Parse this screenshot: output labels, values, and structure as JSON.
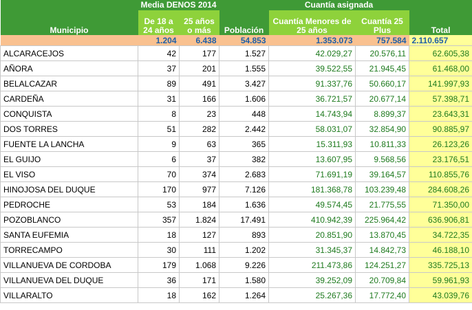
{
  "header": {
    "group_media": "Media DENOS 2014",
    "group_cuantia": "Cuantía asignada",
    "col_municipio": "Municipio",
    "col_18_24": "De 18 a 24 años",
    "col_25_mas": "25 años o más",
    "col_poblacion": "Población",
    "col_menores": "Cuantía Menores de 25 años",
    "col_25plus": "Cuantía 25 Plus",
    "col_total": "Total"
  },
  "totals": {
    "municipio": "",
    "d18_24": "1.204",
    "d25_mas": "6.438",
    "poblacion": "54.853",
    "menores": "1.353.073",
    "plus25": "757.584",
    "total": "2.110.657"
  },
  "rows": [
    {
      "municipio": "ALCARACEJOS",
      "d18_24": "42",
      "d25_mas": "177",
      "poblacion": "1.527",
      "menores": "42.029,27",
      "plus25": "20.576,11",
      "total": "62.605,38"
    },
    {
      "municipio": "AÑORA",
      "d18_24": "37",
      "d25_mas": "201",
      "poblacion": "1.555",
      "menores": "39.522,55",
      "plus25": "21.945,45",
      "total": "61.468,00"
    },
    {
      "municipio": "BELALCAZAR",
      "d18_24": "89",
      "d25_mas": "491",
      "poblacion": "3.427",
      "menores": "91.337,76",
      "plus25": "50.660,17",
      "total": "141.997,93"
    },
    {
      "municipio": "CARDEÑA",
      "d18_24": "31",
      "d25_mas": "166",
      "poblacion": "1.606",
      "menores": "36.721,57",
      "plus25": "20.677,14",
      "total": "57.398,71"
    },
    {
      "municipio": "CONQUISTA",
      "d18_24": "8",
      "d25_mas": "23",
      "poblacion": "448",
      "menores": "14.743,94",
      "plus25": "8.899,37",
      "total": "23.643,31"
    },
    {
      "municipio": "DOS TORRES",
      "d18_24": "51",
      "d25_mas": "282",
      "poblacion": "2.442",
      "menores": "58.031,07",
      "plus25": "32.854,90",
      "total": "90.885,97"
    },
    {
      "municipio": "FUENTE LA LANCHA",
      "d18_24": "9",
      "d25_mas": "63",
      "poblacion": "365",
      "menores": "15.311,93",
      "plus25": "10.811,33",
      "total": "26.123,26"
    },
    {
      "municipio": "EL GUIJO",
      "d18_24": "6",
      "d25_mas": "37",
      "poblacion": "382",
      "menores": "13.607,95",
      "plus25": "9.568,56",
      "total": "23.176,51"
    },
    {
      "municipio": "EL VISO",
      "d18_24": "70",
      "d25_mas": "374",
      "poblacion": "2.683",
      "menores": "71.691,19",
      "plus25": "39.164,57",
      "total": "110.855,76"
    },
    {
      "municipio": "HINOJOSA DEL DUQUE",
      "d18_24": "170",
      "d25_mas": "977",
      "poblacion": "7.126",
      "menores": "181.368,78",
      "plus25": "103.239,48",
      "total": "284.608,26"
    },
    {
      "municipio": "PEDROCHE",
      "d18_24": "53",
      "d25_mas": "184",
      "poblacion": "1.636",
      "menores": "49.574,45",
      "plus25": "21.775,55",
      "total": "71.350,00"
    },
    {
      "municipio": "POZOBLANCO",
      "d18_24": "357",
      "d25_mas": "1.824",
      "poblacion": "17.491",
      "menores": "410.942,39",
      "plus25": "225.964,42",
      "total": "636.906,81"
    },
    {
      "municipio": "SANTA EUFEMIA",
      "d18_24": "18",
      "d25_mas": "127",
      "poblacion": "893",
      "menores": "20.851,90",
      "plus25": "13.870,45",
      "total": "34.722,35"
    },
    {
      "municipio": "TORRECAMPO",
      "d18_24": "30",
      "d25_mas": "111",
      "poblacion": "1.202",
      "menores": "31.345,37",
      "plus25": "14.842,73",
      "total": "46.188,10"
    },
    {
      "municipio": "VILLANUEVA DE CORDOBA",
      "d18_24": "179",
      "d25_mas": "1.068",
      "poblacion": "9.226",
      "menores": "211.473,86",
      "plus25": "124.251,27",
      "total": "335.725,13"
    },
    {
      "municipio": "VILLANUEVA DEL DUQUE",
      "d18_24": "36",
      "d25_mas": "171",
      "poblacion": "1.580",
      "menores": "39.252,09",
      "plus25": "20.709,84",
      "total": "59.961,93"
    },
    {
      "municipio": "VILLARALTO",
      "d18_24": "18",
      "d25_mas": "162",
      "poblacion": "1.264",
      "menores": "25.267,36",
      "plus25": "17.772,40",
      "total": "43.039,76"
    }
  ]
}
